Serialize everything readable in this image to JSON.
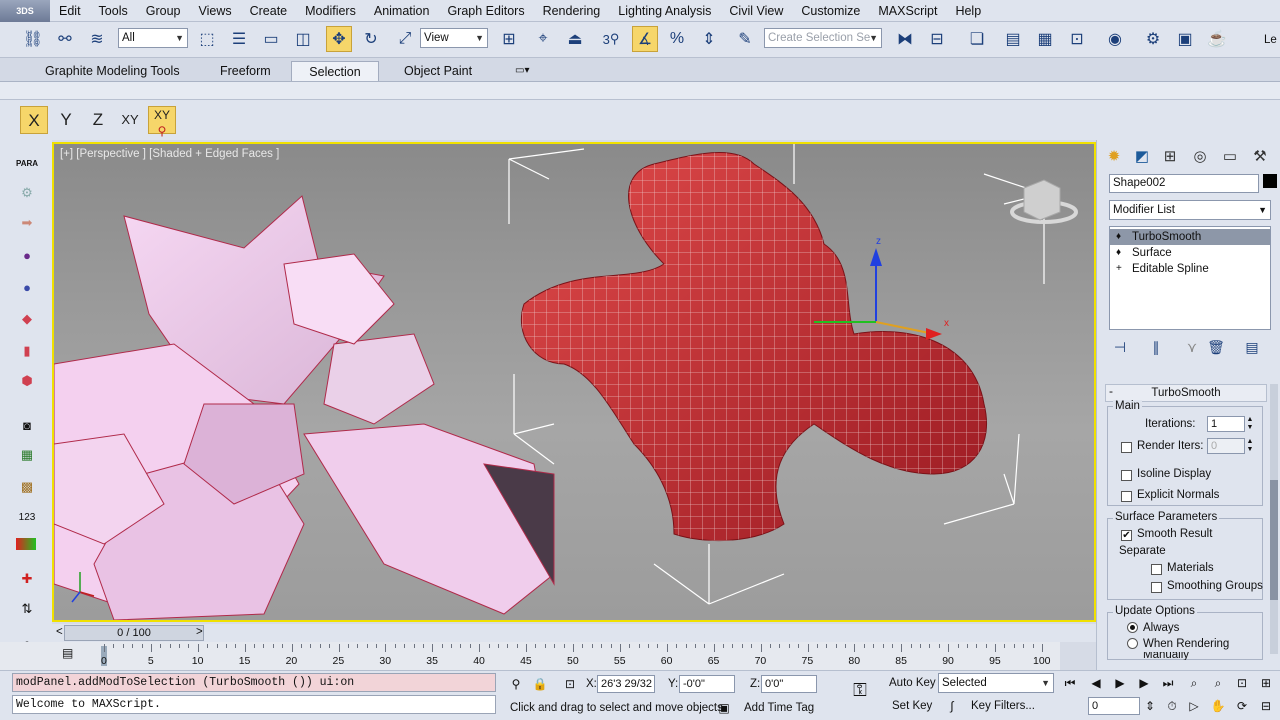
{
  "menubar": {
    "app_icon": "3DS",
    "items": [
      "Edit",
      "Tools",
      "Group",
      "Views",
      "Create",
      "Modifiers",
      "Animation",
      "Graph Editors",
      "Rendering",
      "Lighting Analysis",
      "Civil View",
      "Customize",
      "MAXScript",
      "Help"
    ]
  },
  "toolbar": {
    "filter_value": "All",
    "refcoord_value": "View",
    "snap_label": "3",
    "selection_set_placeholder": "Create Selection Se",
    "right_label": "Le"
  },
  "ribbon": {
    "tabs": [
      "Graphite Modeling Tools",
      "Freeform",
      "Selection",
      "Object Paint"
    ],
    "active_tab": "Selection",
    "options_glyph": "▾"
  },
  "axis": {
    "x": "X",
    "y": "Y",
    "z": "Z",
    "xy": "XY",
    "xy_active": "XY"
  },
  "lefttools": {
    "para_label": "PARA",
    "num_label": "123"
  },
  "viewport": {
    "label": "[+] [Perspective ] [Shaded + Edged Faces ]",
    "gizmo_z": "z",
    "gizmo_x": "x"
  },
  "cmdpanel": {
    "object_name": "Shape002",
    "modifier_list": "Modifier List",
    "stack": [
      {
        "label": "TurboSmooth",
        "icon": "♦"
      },
      {
        "label": "Surface",
        "icon": "♦"
      },
      {
        "label": "Editable Spline",
        "icon": "+"
      }
    ],
    "rollout": {
      "title": "TurboSmooth",
      "collapse": "-",
      "main_group": "Main",
      "iterations_label": "Iterations:",
      "iterations_value": "1",
      "render_iters_label": "Render Iters:",
      "render_iters_value": "0",
      "isoline_label": "Isoline Display",
      "explicit_label": "Explicit Normals",
      "surface_group": "Surface Parameters",
      "smooth_result_label": "Smooth Result",
      "separate_label": "Separate",
      "materials_label": "Materials",
      "smoothing_groups_label": "Smoothing Groups",
      "update_group": "Update Options",
      "always_label": "Always",
      "when_rendering_label": "When Rendering",
      "manually_label": "Manually"
    }
  },
  "timeline": {
    "frame_display": "0 / 100",
    "prev": "<",
    "next": ">",
    "ticks": [
      "0",
      "5",
      "10",
      "15",
      "20",
      "25",
      "30",
      "35",
      "40",
      "45",
      "50",
      "55",
      "60",
      "65",
      "70",
      "75",
      "80",
      "85",
      "90",
      "95",
      "100"
    ]
  },
  "status": {
    "maxscript_line1": "modPanel.addModToSelection (TurboSmooth ()) ui:on",
    "maxscript_line2": "Welcome to MAXScript.",
    "x_label": "X:",
    "x_value": "26'3 29/32",
    "y_label": "Y:",
    "y_value": "-0'0\"",
    "z_label": "Z:",
    "z_value": "0'0\"",
    "prompt": "Click and drag to select and move objects",
    "add_time_tag": "Add Time Tag",
    "auto_key": "Auto Key",
    "set_key": "Set Key",
    "selected_value": "Selected",
    "key_filters": "Key Filters...",
    "frame_value": "0"
  }
}
